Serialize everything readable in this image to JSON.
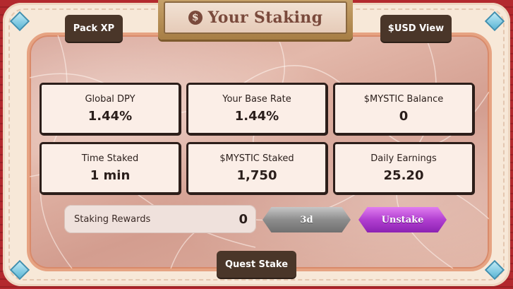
{
  "title": "Your Staking",
  "title_icon": "dollar-coin-icon",
  "top_buttons": {
    "pack_xp": "Pack XP",
    "usd_view": "$USD View"
  },
  "stats": [
    {
      "label": "Global DPY",
      "value": "1.44%"
    },
    {
      "label": "Your Base Rate",
      "value": "1.44%"
    },
    {
      "label": "$MYSTIC Balance",
      "value": "0"
    },
    {
      "label": "Time Staked",
      "value": "1 min"
    },
    {
      "label": "$MYSTIC Staked",
      "value": "1,750"
    },
    {
      "label": "Daily Earnings",
      "value": "25.20"
    }
  ],
  "rewards": {
    "label": "Staking Rewards",
    "value": "0"
  },
  "actions": {
    "duration": "3d",
    "unstake": "Unstake"
  },
  "bottom_button": "Quest Stake",
  "colors": {
    "background": "#a8262a",
    "frame": "#f7e8d8",
    "marble": "#d8a69a",
    "dark_button": "#4a3629",
    "card_bg": "#fbeee7",
    "unstake": "#b13fd0",
    "duration": "#8d8d8d"
  }
}
